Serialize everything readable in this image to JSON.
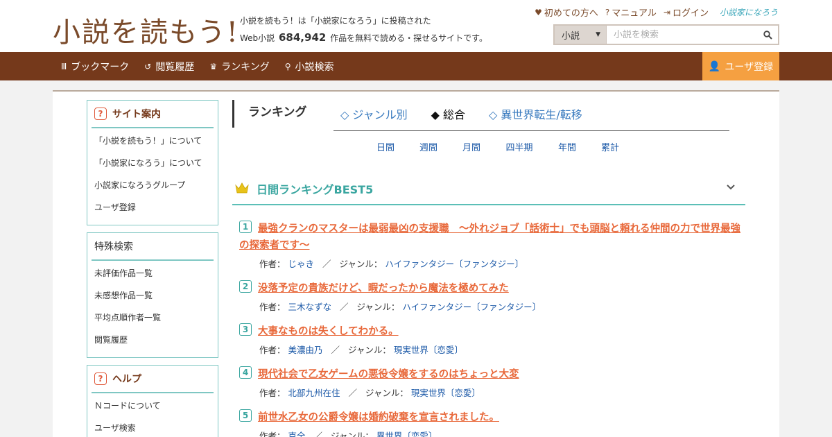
{
  "header": {
    "logo_text": "小説を読もう!",
    "desc_line1": "小説を読もう！は「小説家になろう」に投稿された",
    "desc_prefix": "Web小説",
    "desc_count": "684,942",
    "desc_suffix": "作品を無料で読める・探せるサイトです。",
    "links": [
      {
        "icon": "♥",
        "label": "初めての方へ"
      },
      {
        "icon": "?",
        "label": "マニュアル"
      },
      {
        "icon": "⇥",
        "label": "ログイン"
      }
    ],
    "partner_logo": "小説家になろう",
    "search": {
      "select_value": "小説",
      "placeholder": "小説を検索",
      "icon": "search-icon"
    }
  },
  "nav": {
    "items": [
      {
        "icon": "bookmark-icon",
        "glyph": "Ⅲ",
        "label": "ブックマーク"
      },
      {
        "icon": "history-icon",
        "glyph": "↺",
        "label": "閲覧履歴"
      },
      {
        "icon": "crown-icon",
        "glyph": "♛",
        "label": "ランキング"
      },
      {
        "icon": "search-icon",
        "glyph": "⚲",
        "label": "小説検索"
      }
    ],
    "register": {
      "icon": "user-icon",
      "glyph": "👤",
      "label": "ユーザ登録"
    }
  },
  "sidebar": {
    "guide": {
      "title": "サイト案内",
      "items": [
        "「小説を読もう！」について",
        "「小説家になろう」について",
        "小説家になろうグループ",
        "ユーザ登録"
      ]
    },
    "special": {
      "title": "特殊検索",
      "items": [
        "未評価作品一覧",
        "未感想作品一覧",
        "平均点順作者一覧",
        "閲覧履歴"
      ]
    },
    "help": {
      "title": "ヘルプ",
      "items": [
        "Ｎコードについて",
        "ユーザ検索"
      ]
    }
  },
  "ranking": {
    "title": "ランキング",
    "tabs": [
      "◇ ジャンル別",
      "◆ 総合",
      "◇ 異世界転生/転移"
    ],
    "active_tab": 1,
    "periods": [
      "日間",
      "週間",
      "月間",
      "四半期",
      "年間",
      "累計"
    ],
    "best_title": "日間ランキングBEST5",
    "author_label": "作者：",
    "genre_label": "ジャンル：",
    "entries": [
      {
        "rank": "1",
        "title": "最強クランのマスターは最弱最凶の支援職　～外れジョブ「話術士」でも頭脳と頼れる仲間の力で世界最強の探索者です～",
        "author": "じゃき",
        "genre": "ハイファンタジー〔ファンタジー〕"
      },
      {
        "rank": "2",
        "title": "没落予定の貴族だけど、暇だったから魔法を極めてみた",
        "author": "三木なずな",
        "genre": "ハイファンタジー〔ファンタジー〕"
      },
      {
        "rank": "3",
        "title": "大事なものは失くしてわかる。",
        "author": "美濃由乃",
        "genre": "現実世界〔恋愛〕"
      },
      {
        "rank": "4",
        "title": "現代社会で乙女ゲームの悪役令嬢をするのはちょっと大変",
        "author": "北部九州在住",
        "genre": "現実世界〔恋愛〕"
      },
      {
        "rank": "5",
        "title": "前世水乙女の公爵令嬢は婚約破棄を宣言されました。",
        "author": "克全",
        "genre": "異世界〔恋愛〕"
      }
    ]
  }
}
